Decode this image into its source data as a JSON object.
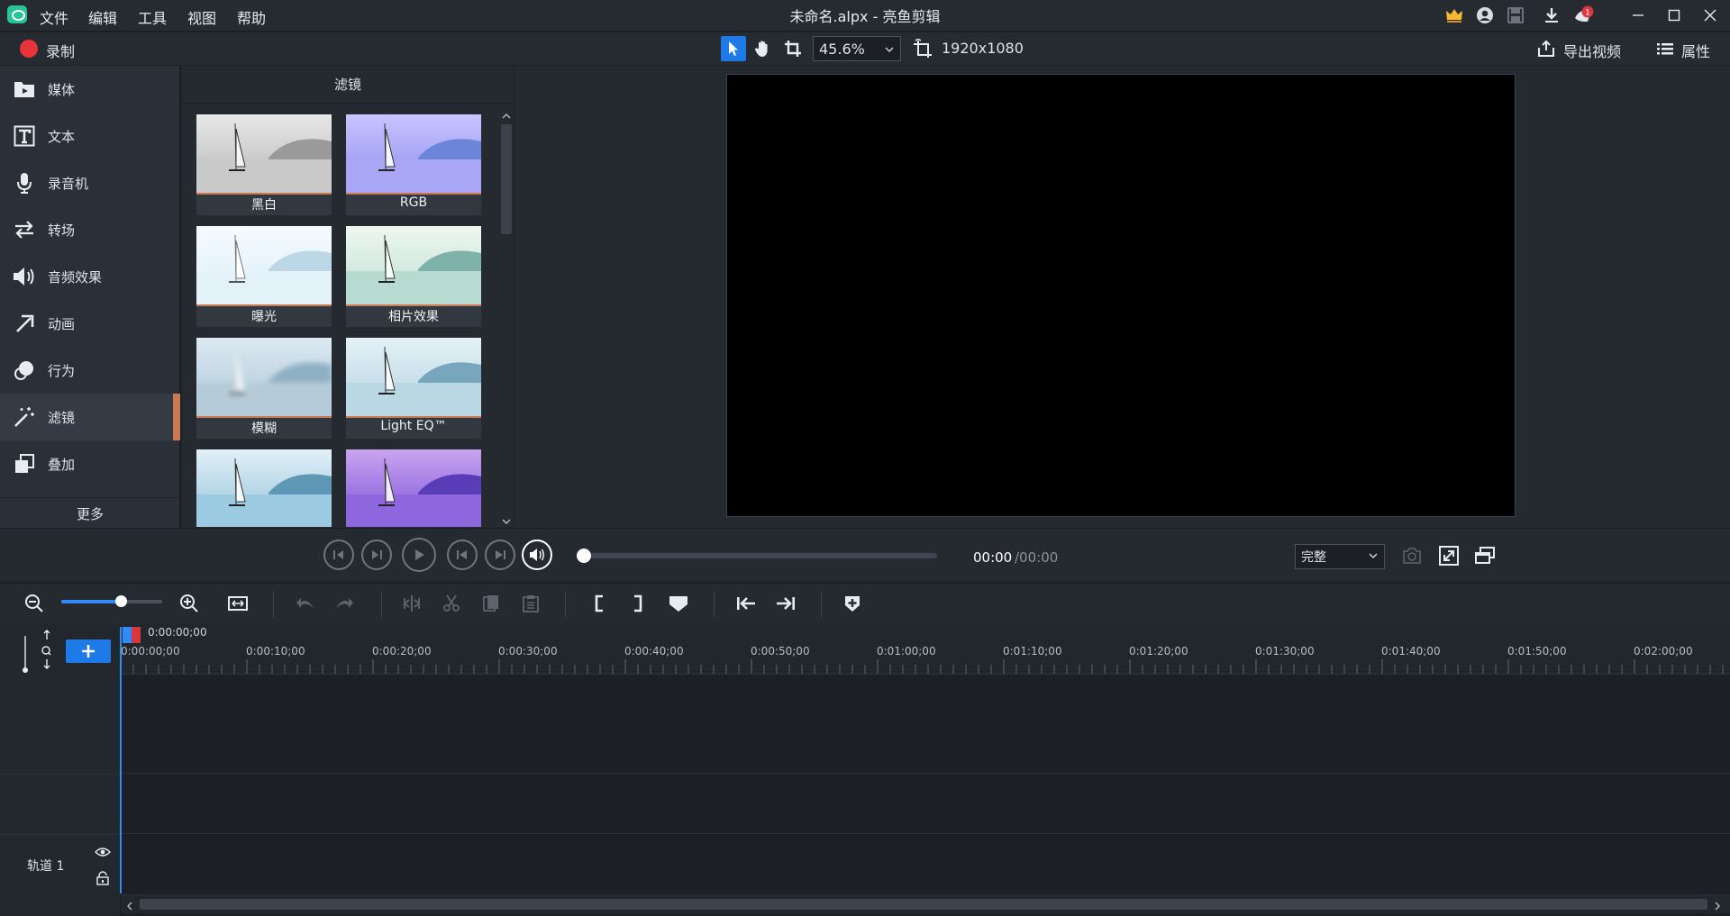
{
  "app": {
    "window_title": "未命名.alpx - 亮鱼剪辑",
    "menu": [
      "文件",
      "编辑",
      "工具",
      "视图",
      "帮助"
    ],
    "notification_count": "1"
  },
  "toolbar": {
    "record_label": "录制",
    "zoom_value": "45.6%",
    "resolution": "1920x1080",
    "export_label": "导出视频",
    "properties_label": "属性"
  },
  "sidebar": {
    "items": [
      {
        "label": "媒体",
        "icon": "media-folder-icon"
      },
      {
        "label": "文本",
        "icon": "text-icon"
      },
      {
        "label": "录音机",
        "icon": "microphone-icon"
      },
      {
        "label": "转场",
        "icon": "transition-arrows-icon"
      },
      {
        "label": "音频效果",
        "icon": "speaker-icon"
      },
      {
        "label": "动画",
        "icon": "arrow-animation-icon"
      },
      {
        "label": "行为",
        "icon": "behavior-icon"
      },
      {
        "label": "滤镜",
        "icon": "magic-wand-icon",
        "active": true
      },
      {
        "label": "叠加",
        "icon": "overlay-icon"
      }
    ],
    "more_label": "更多",
    "accent": "#c97a52"
  },
  "filters": {
    "header": "滤镜",
    "items": [
      {
        "label": "黑白"
      },
      {
        "label": "RGB"
      },
      {
        "label": "曝光"
      },
      {
        "label": "相片效果"
      },
      {
        "label": "模糊"
      },
      {
        "label": "Light EQ™"
      },
      {
        "label": ""
      },
      {
        "label": ""
      }
    ]
  },
  "playback": {
    "time_current": "00:00",
    "time_total": "/00:00",
    "quality": "完整"
  },
  "timeline": {
    "playhead_time": "0:00:00;00",
    "ruler": [
      "0:00:00;00",
      "0:00:10;00",
      "0:00:20;00",
      "0:00:30;00",
      "0:00:40;00",
      "0:00:50;00",
      "0:01:00;00",
      "0:01:10;00",
      "0:01:20;00",
      "0:01:30;00",
      "0:01:40;00",
      "0:01:50;00",
      "0:02:00;00"
    ],
    "track_label": "轨道 1",
    "accent": "#2f8cf6"
  }
}
